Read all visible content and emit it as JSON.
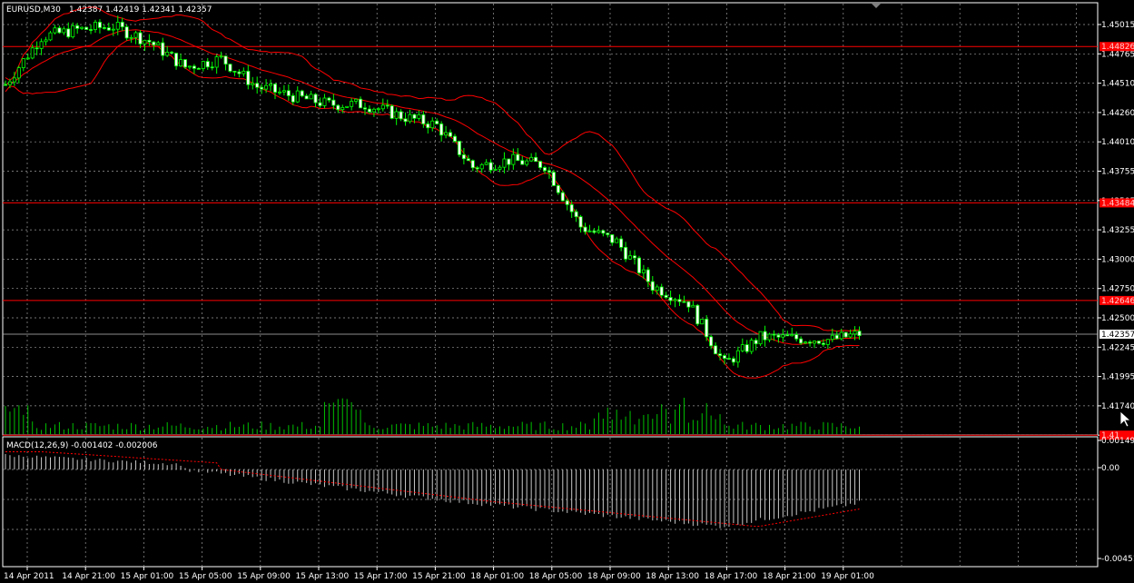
{
  "header": {
    "symbol": "EURUSD,M30",
    "ohlc": "1.42387 1.42419 1.42341 1.42357"
  },
  "macd": {
    "label": "MACD(12,26,9) -0.001402 -0.002006"
  },
  "colors": {
    "background": "#000000",
    "grid": "#9a9a9a",
    "bull": "#00ff00",
    "bear": "#ffffff",
    "bands": "#ff0000",
    "level": "#ff0000",
    "volume": "#00c000",
    "macd_hist": "#c8c8c8",
    "macd_signal": "#ff0000",
    "price_tag_bg": "#ff0000"
  },
  "price_axis": {
    "ticks": [
      "1.45015",
      "1.44765",
      "1.44510",
      "1.44260",
      "1.44010",
      "1.43755",
      "1.43505",
      "1.43255",
      "1.43000",
      "1.42750",
      "1.42500",
      "1.42245",
      "1.41995",
      "1.41740",
      "1.41490"
    ],
    "range": [
      1.4138,
      1.4512
    ]
  },
  "price_tags": {
    "levels": [
      "1.44826",
      "1.43484",
      "1.42646",
      "1.41"
    ],
    "current": "1.42357"
  },
  "macd_axis": {
    "ticks": [
      "0.00149",
      "0.00",
      "-0.00451"
    ]
  },
  "time_axis": {
    "labels": [
      "14 Apr 2011",
      "14 Apr 21:00",
      "15 Apr 01:00",
      "15 Apr 05:00",
      "15 Apr 09:00",
      "15 Apr 13:00",
      "15 Apr 17:00",
      "15 Apr 21:00",
      "18 Apr 01:00",
      "18 Apr 05:00",
      "18 Apr 09:00",
      "18 Apr 13:00",
      "18 Apr 17:00",
      "18 Apr 21:00",
      "19 Apr 01:00"
    ]
  },
  "chart_data": {
    "type": "candlestick",
    "symbol": "EURUSD",
    "timeframe": "M30",
    "indicators": [
      "Bollinger Bands",
      "Volumes",
      "MACD(12,26,9)"
    ],
    "horizontal_levels": [
      1.44826,
      1.43484,
      1.42646,
      1.4149
    ],
    "last_price": 1.42357,
    "close_path_points": [
      [
        0,
        1.445
      ],
      [
        8,
        1.4491
      ],
      [
        16,
        1.4497
      ],
      [
        24,
        1.45
      ],
      [
        32,
        1.4487
      ],
      [
        40,
        1.4465
      ],
      [
        48,
        1.4472
      ],
      [
        56,
        1.4448
      ],
      [
        64,
        1.444
      ],
      [
        72,
        1.4433
      ],
      [
        80,
        1.4433
      ],
      [
        88,
        1.4423
      ],
      [
        96,
        1.4415
      ],
      [
        104,
        1.4379
      ],
      [
        112,
        1.4385
      ],
      [
        120,
        1.4381
      ],
      [
        128,
        1.4328
      ],
      [
        136,
        1.4315
      ],
      [
        144,
        1.4277
      ],
      [
        152,
        1.4263
      ],
      [
        160,
        1.421
      ],
      [
        168,
        1.4233
      ],
      [
        176,
        1.4232
      ],
      [
        184,
        1.4231
      ],
      [
        190,
        1.4236
      ]
    ],
    "macd_main_end": -0.001402,
    "macd_signal_end": -0.002006
  }
}
